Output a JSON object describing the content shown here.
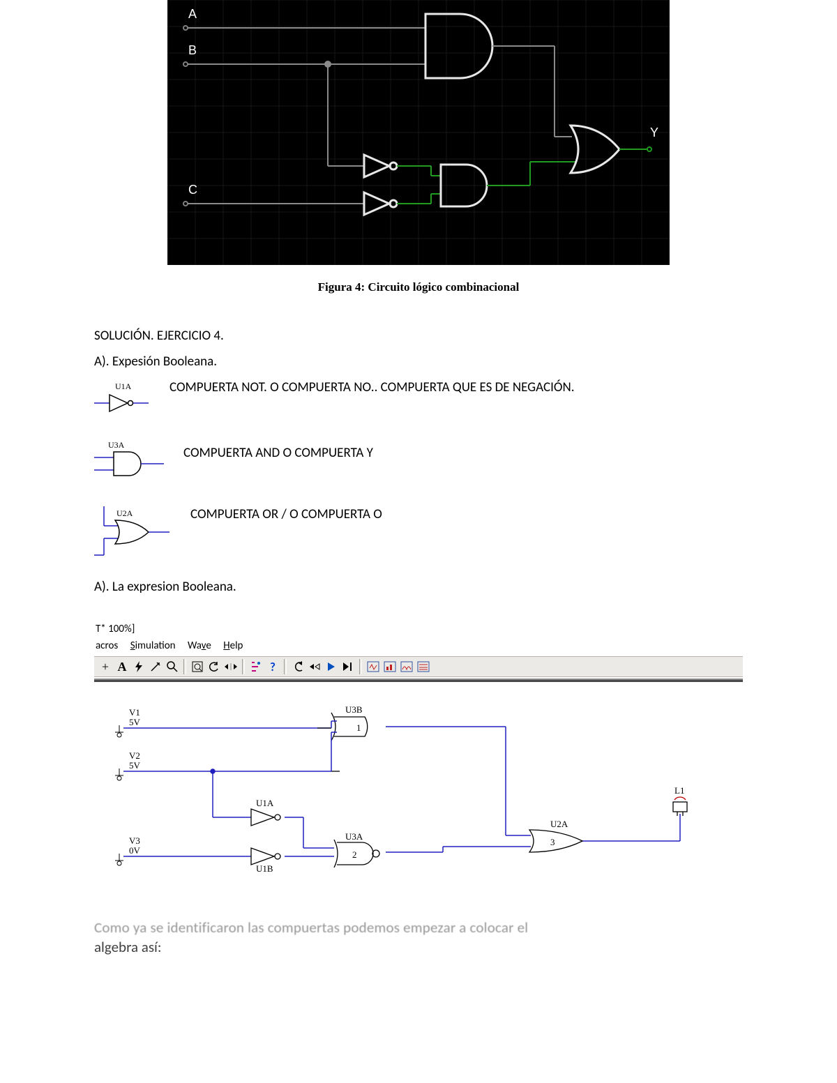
{
  "figure": {
    "caption": "Figura 4:  Circuito lógico combinacional",
    "inputs": {
      "a": "A",
      "b": "B",
      "c": "C"
    },
    "output": "Y"
  },
  "text": {
    "solucion": "SOLUCIÓN.    EJERCICIO 4.",
    "aExp": "A).  Expesión Booleana.",
    "gateNotLabel": "U1A",
    "gateNotDesc": "COMPUERTA NOT.    O COMPUERTA  NO..  COMPUERTA QUE ES DE NEGACIÓN.",
    "gateAndLabel": "U3A",
    "gateAndDesc": "COMPUERTA  AND O COMPUERTA  Y",
    "gateOrLabel": "U2A",
    "gateOrDesc": "COMPUERTA OR / O COMPUERTA O",
    "aExp2": "A). La expresion Booleana.",
    "bottomBlur": "Como ya se identificaron las compuertas podemos empezar a colocar el",
    "bottomClear": "algebra así:"
  },
  "sim": {
    "titleZoom": "T* 100%]",
    "menus": [
      "acros",
      "Simulation",
      "Wave",
      "Help"
    ],
    "nodes": {
      "v1": "V1",
      "v1v": "5V",
      "v2": "V2",
      "v2v": "5V",
      "v3": "V3",
      "v3v": "0V",
      "u1a": "U1A",
      "u1b": "U1B",
      "u2a": "U2A",
      "u3a": "U3A",
      "u3b": "U3B",
      "u2aNum": "3",
      "u3aNum": "2",
      "u3bNum": "1",
      "l1": "L1"
    }
  }
}
